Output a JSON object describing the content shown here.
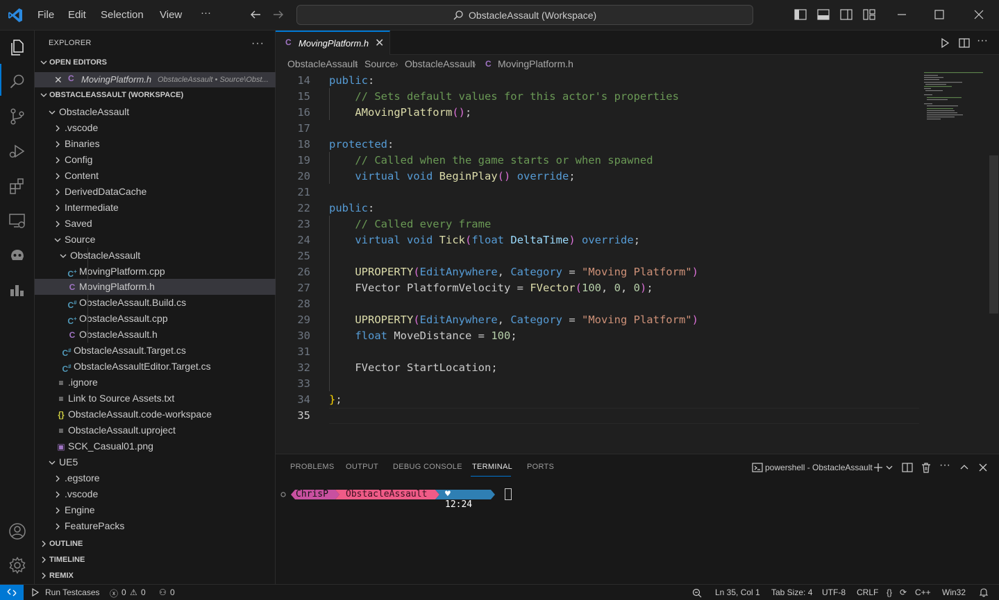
{
  "menu": {
    "file": "File",
    "edit": "Edit",
    "selection": "Selection",
    "view": "View",
    "more": "···"
  },
  "command_center": {
    "text": "ObstacleAssault (Workspace)"
  },
  "explorer": {
    "title": "EXPLORER",
    "open_editors_label": "OPEN EDITORS",
    "open_editor": {
      "name": "MovingPlatform.h",
      "path": "ObstacleAssault • Source\\Obst..."
    },
    "workspace_label": "OBSTACLEASSAULT (WORKSPACE)",
    "tree": [
      {
        "label": "ObstacleAssault",
        "kind": "folder-open",
        "depth": 0
      },
      {
        "label": ".vscode",
        "kind": "folder",
        "depth": 1
      },
      {
        "label": "Binaries",
        "kind": "folder",
        "depth": 1
      },
      {
        "label": "Config",
        "kind": "folder",
        "depth": 1
      },
      {
        "label": "Content",
        "kind": "folder",
        "depth": 1
      },
      {
        "label": "DerivedDataCache",
        "kind": "folder",
        "depth": 1
      },
      {
        "label": "Intermediate",
        "kind": "folder",
        "depth": 1
      },
      {
        "label": "Saved",
        "kind": "folder",
        "depth": 1
      },
      {
        "label": "Source",
        "kind": "folder-open",
        "depth": 1
      },
      {
        "label": "ObstacleAssault",
        "kind": "folder-open",
        "depth": 2
      },
      {
        "label": "MovingPlatform.cpp",
        "kind": "cpp",
        "depth": 3
      },
      {
        "label": "MovingPlatform.h",
        "kind": "h",
        "depth": 3,
        "selected": true
      },
      {
        "label": "ObstacleAssault.Build.cs",
        "kind": "cs",
        "depth": 3
      },
      {
        "label": "ObstacleAssault.cpp",
        "kind": "cpp",
        "depth": 3
      },
      {
        "label": "ObstacleAssault.h",
        "kind": "h",
        "depth": 3
      },
      {
        "label": "ObstacleAssault.Target.cs",
        "kind": "cs",
        "depth": 2
      },
      {
        "label": "ObstacleAssaultEditor.Target.cs",
        "kind": "cs",
        "depth": 2
      },
      {
        "label": ".ignore",
        "kind": "txt",
        "depth": 1
      },
      {
        "label": "Link to Source Assets.txt",
        "kind": "txt",
        "depth": 1
      },
      {
        "label": "ObstacleAssault.code-workspace",
        "kind": "json",
        "depth": 1
      },
      {
        "label": "ObstacleAssault.uproject",
        "kind": "txt",
        "depth": 1
      },
      {
        "label": "SCK_Casual01.png",
        "kind": "img",
        "depth": 1
      },
      {
        "label": "UE5",
        "kind": "folder-open",
        "depth": 0
      },
      {
        "label": ".egstore",
        "kind": "folder",
        "depth": 1
      },
      {
        "label": ".vscode",
        "kind": "folder",
        "depth": 1
      },
      {
        "label": "Engine",
        "kind": "folder",
        "depth": 1
      },
      {
        "label": "FeaturePacks",
        "kind": "folder",
        "depth": 1
      }
    ],
    "outline_label": "OUTLINE",
    "timeline_label": "TIMELINE",
    "remix_label": "REMIX"
  },
  "tab": {
    "name": "MovingPlatform.h",
    "icon_letter": "C"
  },
  "breadcrumbs": [
    "ObstacleAssault",
    "Source",
    "ObstacleAssault",
    "MovingPlatform.h"
  ],
  "editor": {
    "line_numbers": [
      "14",
      "15",
      "16",
      "17",
      "18",
      "19",
      "20",
      "21",
      "22",
      "23",
      "24",
      "25",
      "26",
      "27",
      "28",
      "29",
      "30",
      "31",
      "32",
      "33",
      "34",
      "35"
    ],
    "current_line": "35"
  },
  "panel": {
    "tabs": [
      "PROBLEMS",
      "OUTPUT",
      "DEBUG CONSOLE",
      "TERMINAL",
      "PORTS"
    ],
    "active_tab": "TERMINAL",
    "terminal_name": "powershell - ObstacleAssault",
    "prompt_user": "ChrisP",
    "prompt_dir": "ObstacleAssault",
    "prompt_time": "♥ 12:24"
  },
  "status": {
    "run_testcases": "Run Testcases",
    "errors": "0",
    "warnings": "0",
    "ports": "0",
    "position": "Ln 35, Col 1",
    "tab_size": "Tab Size: 4",
    "encoding": "UTF-8",
    "eol": "CRLF",
    "language": "C++",
    "platform": "Win32"
  },
  "colors": {
    "accent": "#0078d4",
    "keyword": "#569cd6",
    "comment": "#6a9955",
    "string": "#ce9178",
    "number": "#b5cea8",
    "function": "#dcdcaa",
    "header_icon": "#a074c4",
    "cs_icon": "#519aba"
  }
}
